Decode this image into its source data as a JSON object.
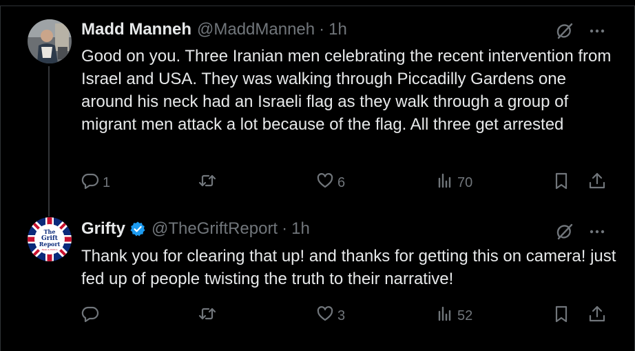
{
  "colors": {
    "background": "#000000",
    "text": "#e7e9ea",
    "muted": "#71767b",
    "verified": "#1d9bf0",
    "border": "#2f3336"
  },
  "tweets": [
    {
      "name": "Madd Manneh",
      "handle": "@MaddManneh",
      "separator": "·",
      "time": "1h",
      "verified": false,
      "text": "Good on you.  Three Iranian men celebrating the recent intervention from Israel and USA. They was walking through Piccadilly Gardens one around his neck had an Israeli flag as they walk through a group of migrant men attack a lot because of the flag. All three get arrested",
      "replies": "1",
      "reposts": "",
      "likes": "6",
      "views": "70",
      "icons": [
        "reply-icon",
        "repost-icon",
        "like-icon",
        "views-icon",
        "bookmark-icon",
        "share-icon",
        "grok-icon",
        "more-icon"
      ]
    },
    {
      "name": "Grifty",
      "handle": "@TheGriftReport",
      "separator": "·",
      "time": "1h",
      "verified": true,
      "avatar_text": {
        "line1": "The",
        "line2": "Grift",
        "line3": "Report",
        "line4": "News & Politics"
      },
      "text": "Thank you for clearing that up! and thanks for getting this on camera! just fed up of people twisting the truth to their narrative!",
      "replies": "",
      "reposts": "",
      "likes": "3",
      "views": "52",
      "icons": [
        "reply-icon",
        "repost-icon",
        "like-icon",
        "views-icon",
        "bookmark-icon",
        "share-icon",
        "grok-icon",
        "more-icon"
      ]
    }
  ]
}
